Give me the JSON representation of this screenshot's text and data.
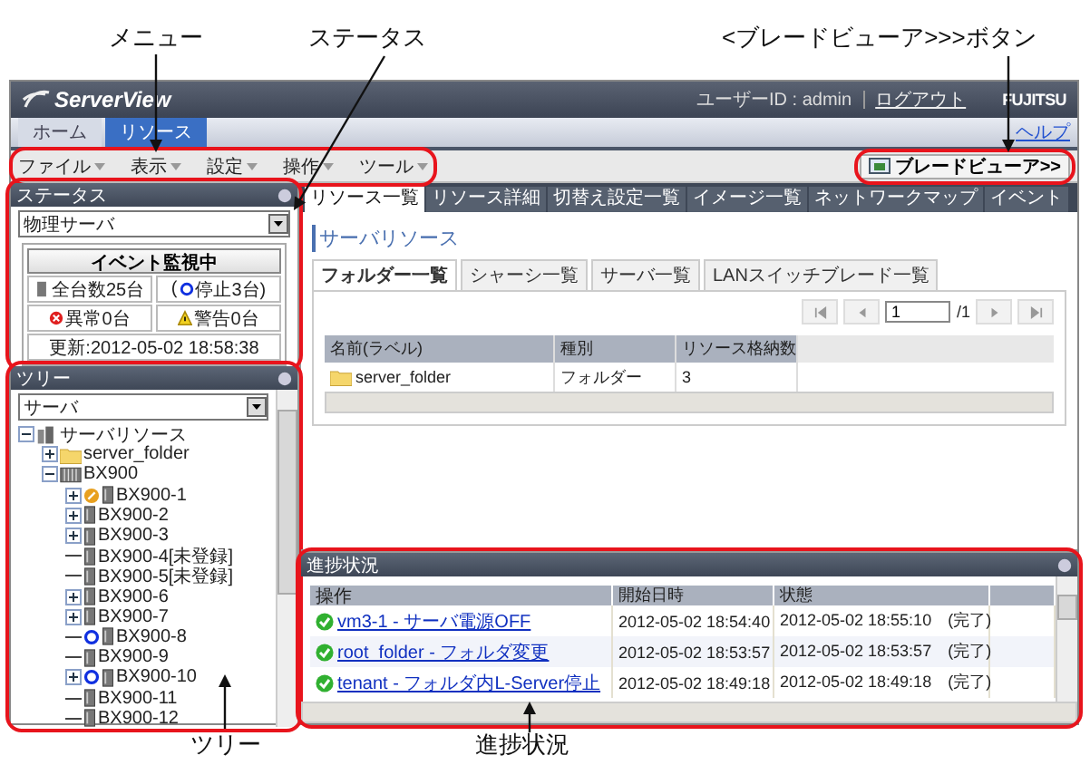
{
  "callouts": {
    "menu": "メニュー",
    "status": "ステータス",
    "blade_button": "<ブレードビューア>>>ボタン",
    "tree": "ツリー",
    "progress": "進捗状況"
  },
  "header": {
    "logo": "ServerView",
    "user": "ユーザーID : admin",
    "logout": "ログアウト",
    "brand": "FUJITSU"
  },
  "main_tabs": [
    {
      "label": "ホーム",
      "selected": false
    },
    {
      "label": "リソース",
      "selected": true
    }
  ],
  "help": "ヘルプ",
  "menu": [
    "ファイル",
    "表示",
    "設定",
    "操作",
    "ツール"
  ],
  "blade_viewer_button": "ブレードビューア>>",
  "status_panel": {
    "title": "ステータス",
    "view": "物理サーバ",
    "monitor": "イベント監視中",
    "total": "全台数25台",
    "stopped_prefix": "(",
    "stopped": "停止3台)",
    "error": "異常0台",
    "warning": "警告0台",
    "updated": "更新:2012-05-02 18:58:38"
  },
  "tree_panel": {
    "title": "ツリー",
    "view": "サーバ",
    "nodes": [
      {
        "label": "サーバリソース",
        "kind": "root",
        "expandable": true,
        "expanded": true,
        "maintenance": false,
        "stopped": false,
        "children": [
          {
            "label": "server_folder",
            "kind": "folder",
            "expandable": true,
            "expanded": false,
            "maintenance": false,
            "stopped": false
          },
          {
            "label": "BX900",
            "kind": "chassis",
            "expandable": true,
            "expanded": true,
            "maintenance": false,
            "stopped": false,
            "children": [
              {
                "label": "BX900-1",
                "kind": "server",
                "expandable": true,
                "expanded": false,
                "maintenance": true,
                "stopped": false
              },
              {
                "label": "BX900-2",
                "kind": "server",
                "expandable": true,
                "expanded": false,
                "maintenance": false,
                "stopped": false
              },
              {
                "label": "BX900-3",
                "kind": "server",
                "expandable": true,
                "expanded": false,
                "maintenance": false,
                "stopped": false
              },
              {
                "label": "BX900-4[未登録]",
                "kind": "server",
                "expandable": false,
                "maintenance": false,
                "stopped": false
              },
              {
                "label": "BX900-5[未登録]",
                "kind": "server",
                "expandable": false,
                "maintenance": false,
                "stopped": false
              },
              {
                "label": "BX900-6",
                "kind": "server",
                "expandable": true,
                "expanded": false,
                "maintenance": false,
                "stopped": false
              },
              {
                "label": "BX900-7",
                "kind": "server",
                "expandable": true,
                "expanded": false,
                "maintenance": false,
                "stopped": false
              },
              {
                "label": "BX900-8",
                "kind": "server",
                "expandable": false,
                "maintenance": false,
                "stopped": true
              },
              {
                "label": "BX900-9",
                "kind": "server",
                "expandable": false,
                "maintenance": false,
                "stopped": false
              },
              {
                "label": "BX900-10",
                "kind": "server",
                "expandable": true,
                "expanded": false,
                "maintenance": false,
                "stopped": true
              },
              {
                "label": "BX900-11",
                "kind": "server",
                "expandable": false,
                "maintenance": false,
                "stopped": false
              },
              {
                "label": "BX900-12",
                "kind": "server",
                "expandable": false,
                "maintenance": false,
                "stopped": false
              }
            ]
          }
        ]
      }
    ]
  },
  "resource_tabs": [
    {
      "label": "リソース一覧",
      "selected": true
    },
    {
      "label": "リソース詳細",
      "selected": false
    },
    {
      "label": "切替え設定一覧",
      "selected": false
    },
    {
      "label": "イメージ一覧",
      "selected": false
    },
    {
      "label": "ネットワークマップ",
      "selected": false
    },
    {
      "label": "イベント",
      "selected": false
    }
  ],
  "resource_title": "サーバリソース",
  "sub_tabs": [
    {
      "label": "フォルダー一覧",
      "selected": true
    },
    {
      "label": "シャーシ一覧",
      "selected": false
    },
    {
      "label": "サーバ一覧",
      "selected": false
    },
    {
      "label": "LANスイッチブレード一覧",
      "selected": false
    }
  ],
  "pager": {
    "page": "1",
    "total": "/1"
  },
  "resource_table": {
    "columns": [
      "名前(ラベル)",
      "種別",
      "リソース格納数"
    ],
    "rows": [
      {
        "name": "server_folder",
        "type": "フォルダー",
        "count": "3"
      }
    ]
  },
  "progress_panel": {
    "title": "進捗状況",
    "columns": [
      "操作",
      "開始日時",
      "状態"
    ],
    "rows": [
      {
        "operation": "vm3-1 - サーバ電源OFF",
        "start": "2012-05-02 18:54:40",
        "state": "2012-05-02 18:55:10　(完了)"
      },
      {
        "operation": "root_folder - フォルダ変更",
        "start": "2012-05-02 18:53:57",
        "state": "2012-05-02 18:53:57　(完了)"
      },
      {
        "operation": "tenant - フォルダ内L-Server停止",
        "start": "2012-05-02 18:49:18",
        "state": "2012-05-02 18:49:18　(完了)"
      }
    ]
  }
}
